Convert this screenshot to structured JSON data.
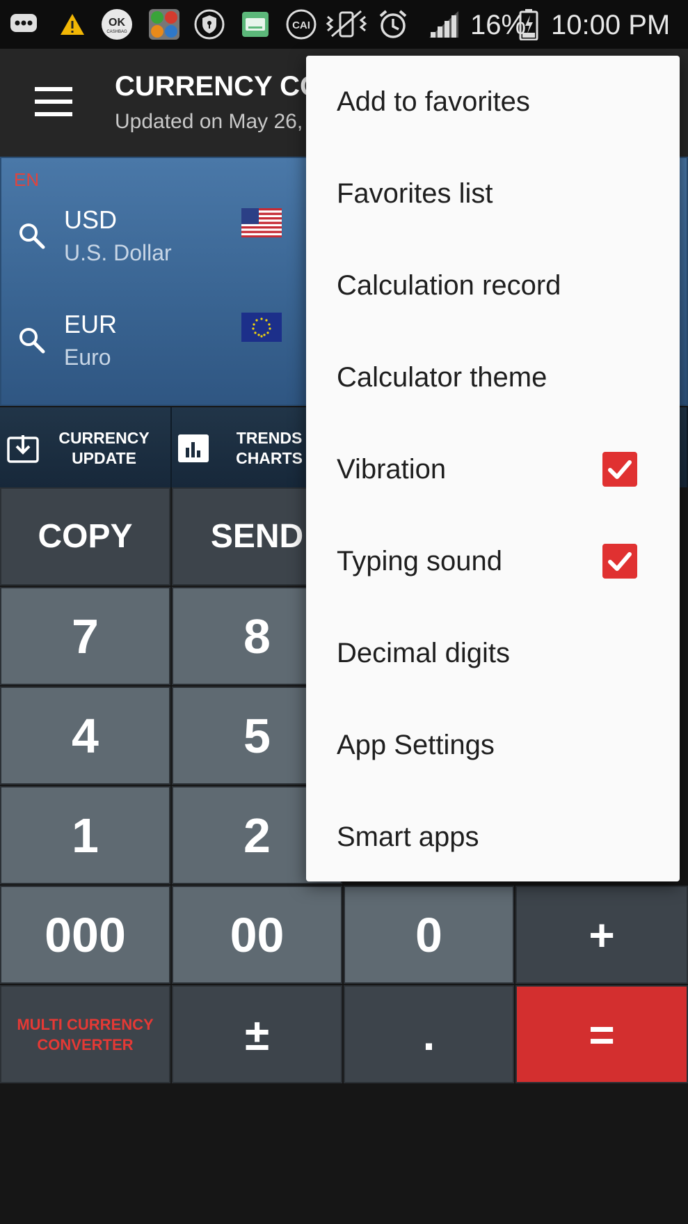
{
  "status_bar": {
    "battery": "16%",
    "time": "10:00 PM",
    "icons": [
      "chat-bubble-icon",
      "warning-icon",
      "ok-cashbag-icon",
      "currency-app-icon",
      "shield-icon",
      "keyboard-icon",
      "cai-icon",
      "vibrate-mute-icon",
      "alarm-icon",
      "signal-icon",
      "battery-icon"
    ],
    "ok_label": "OK",
    "cashbag_label": "CASHBAG",
    "cai_label": "CAI"
  },
  "app_bar": {
    "title": "CURRENCY CO",
    "subtitle": "Updated on May 26,"
  },
  "currency_panel": {
    "language": "EN",
    "rows": [
      {
        "code": "USD",
        "name": "U.S. Dollar",
        "flag": "us-flag"
      },
      {
        "code": "EUR",
        "name": "Euro",
        "flag": "eu-flag"
      }
    ]
  },
  "function_row": {
    "currency_update": "CURRENCY\nUPDATE",
    "trends_charts": "TRENDS\nCHARTS"
  },
  "keypad": {
    "copy": "COPY",
    "send": "SEND",
    "k7": "7",
    "k8": "8",
    "k4": "4",
    "k5": "5",
    "k1": "1",
    "k2": "2",
    "k000": "000",
    "k00": "00",
    "k0": "0",
    "plus": "+",
    "multi": "MULTI CURRENCY\nCONVERTER",
    "plus_minus": "±",
    "decimal": ".",
    "equals": "=",
    "accent_red": "#d32f2f"
  },
  "menu": {
    "items": [
      {
        "label": "Add to favorites",
        "checked": null
      },
      {
        "label": "Favorites list",
        "checked": null
      },
      {
        "label": "Calculation record",
        "checked": null
      },
      {
        "label": "Calculator theme",
        "checked": null
      },
      {
        "label": "Vibration",
        "checked": true
      },
      {
        "label": "Typing sound",
        "checked": true
      },
      {
        "label": "Decimal digits",
        "checked": null
      },
      {
        "label": "App Settings",
        "checked": null
      },
      {
        "label": "Smart apps",
        "checked": null
      }
    ],
    "checkbox_color": "#e03131"
  }
}
